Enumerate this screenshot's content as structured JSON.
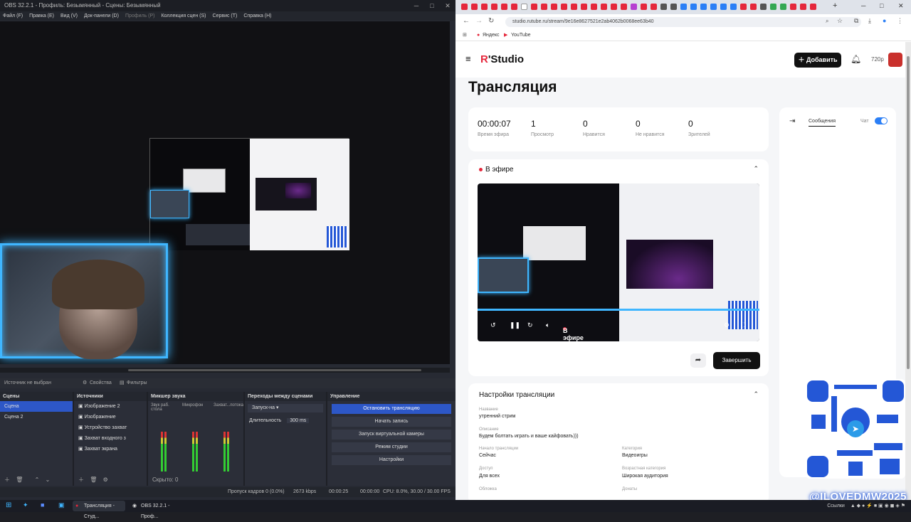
{
  "obs": {
    "title": "OBS 32.2.1 - Профиль: Безымянный - Сцены: Безымянный",
    "menu": [
      "Файл (F)",
      "Правка (E)",
      "Вид (V)",
      "Док-панели (D)",
      "Профиль (P)",
      "Коллекция сцен (S)",
      "Сервис (T)",
      "Справка (H)"
    ],
    "source_bar": {
      "no_source": "Источник не выбран",
      "properties": "Свойства",
      "filters": "Фильтры"
    },
    "scenes": {
      "title": "Сцены",
      "items": [
        "Сцена",
        "Сцена 2"
      ]
    },
    "sources": {
      "title": "Источники",
      "items": [
        "Изображение 2",
        "Изображение",
        "Устройство захват",
        "Захват входного з",
        "Захват экрана"
      ]
    },
    "mixer": {
      "title": "Микшер звука",
      "channels": [
        "Звук раб. стола",
        "Микрофон",
        "Захват...потока"
      ],
      "footer": "Скрыто: 0"
    },
    "transitions": {
      "title": "Переходы между сценами",
      "type": "Запуск-на",
      "duration_label": "Длительность",
      "duration_value": "300 ms"
    },
    "controls": {
      "title": "Управление",
      "buttons": [
        "Остановить трансляцию",
        "Начать запись",
        "Запуск виртуальной камеры",
        "Режим студии",
        "Настройки"
      ]
    },
    "status": {
      "dropped": "Пропуск кадров 0 (0.0%)",
      "bitrate": "2673 kbps",
      "stream_time": "00:00:25",
      "rec_time": "00:00:00",
      "cpu": "CPU: 8.0%, 30.00 / 30.00 FPS"
    }
  },
  "browser": {
    "url": "studio.rutube.ru/stream/9e16e8627521e2ab4062b0068ee63b40",
    "bookmarks": [
      "Яндекс",
      "YouTube"
    ]
  },
  "studio": {
    "logo_r": "R",
    "logo_text": "Studio",
    "add_button": "Добавить",
    "quality": "720p",
    "page_title": "Трансляция",
    "stats": [
      {
        "value": "00:00:07",
        "label": "Время эфира"
      },
      {
        "value": "1",
        "label": "Просмотр"
      },
      {
        "value": "0",
        "label": "Нравится"
      },
      {
        "value": "0",
        "label": "Не нравится"
      },
      {
        "value": "0",
        "label": "Зрителей"
      }
    ],
    "live_label": "В эфире",
    "player_live_label": "В эфире",
    "finish_button": "Завершить",
    "chat": {
      "tab": "Сообщения",
      "chat_label": "Чат"
    },
    "settings": {
      "title": "Настройки трансляции",
      "name_label": "Название",
      "name_value": "утренний стрим",
      "desc_label": "Описание",
      "desc_value": "Будем болтать играть и ваше кайфовать)))",
      "start_label": "Начало трансляции",
      "start_value": "Сейчас",
      "category_label": "Категория",
      "category_value": "Видеоигры",
      "access_label": "Доступ",
      "access_value": "Для всех",
      "age_label": "Возрастная категория",
      "age_value": "Широкая аудитория",
      "cover_label": "Обложка",
      "donate_label": "Донаты"
    }
  },
  "overlay": {
    "watermark": "@ILOVEDMW2025"
  },
  "taskbar": {
    "apps": [
      "Трансляция - Студ...",
      "OBS 32.2.1 - Проф..."
    ],
    "tray": "Ссылки"
  },
  "colors": {
    "accent_red": "#e5273b",
    "obs_blue": "#2d57c7",
    "glow": "#3fb6ff"
  }
}
